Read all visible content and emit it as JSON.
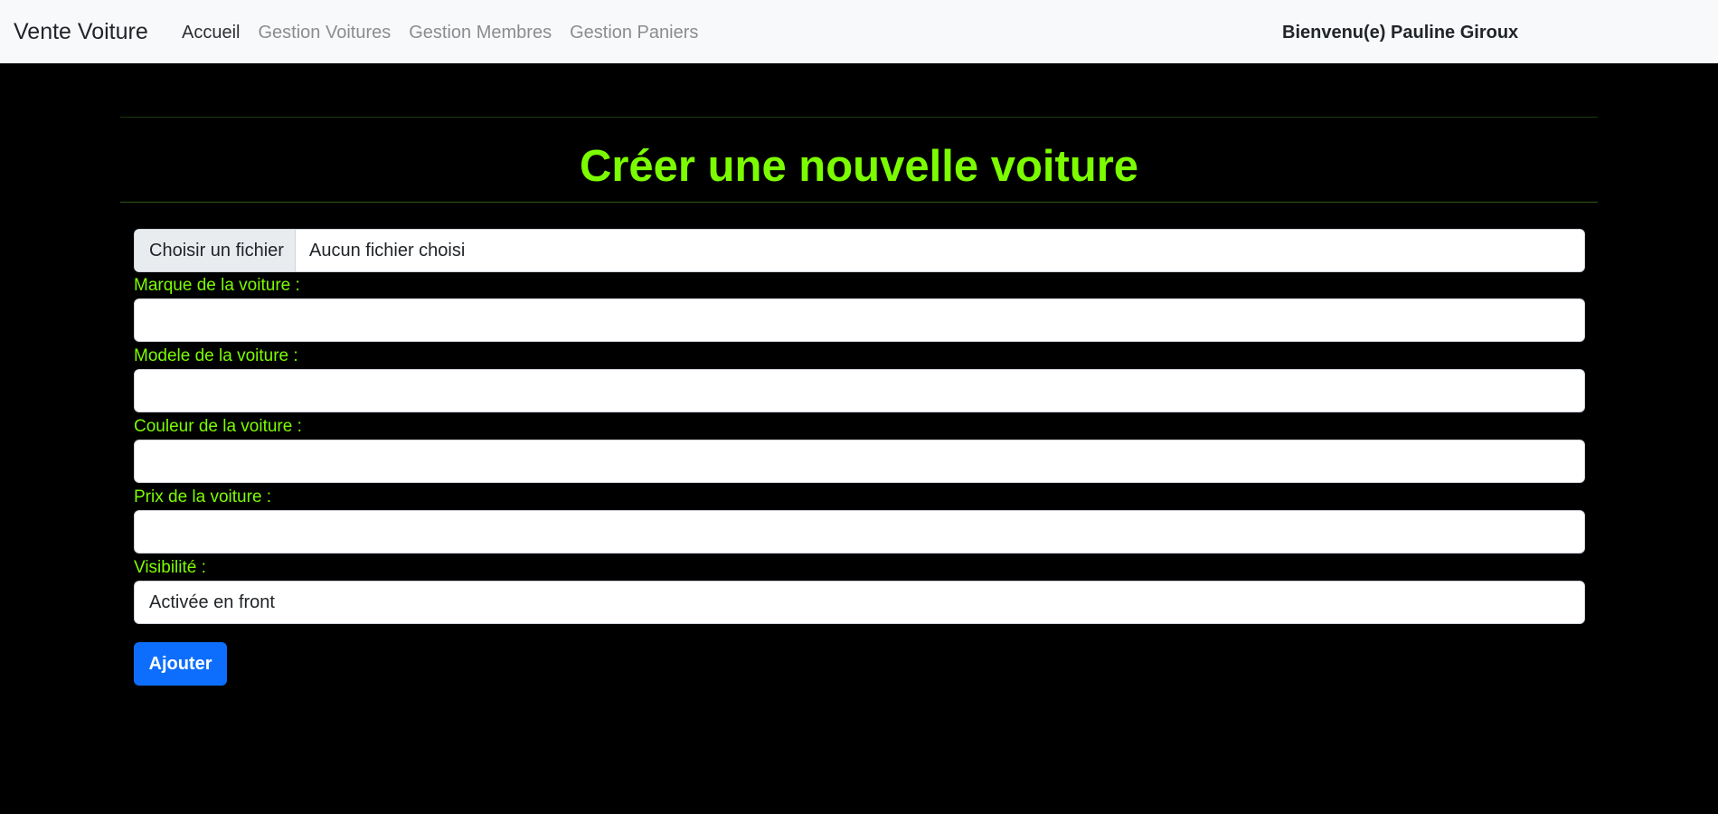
{
  "navbar": {
    "brand": "Vente Voiture",
    "links": [
      {
        "label": "Accueil",
        "active": true
      },
      {
        "label": "Gestion Voitures",
        "active": false
      },
      {
        "label": "Gestion Membres",
        "active": false
      },
      {
        "label": "Gestion Paniers",
        "active": false
      }
    ],
    "welcome": "Bienvenu(e) Pauline Giroux"
  },
  "page": {
    "title": "Créer une nouvelle voiture"
  },
  "form": {
    "file": {
      "button_label": "Choisir un fichier",
      "status": "Aucun fichier choisi"
    },
    "fields": [
      {
        "label": "Marque de la voiture :",
        "value": ""
      },
      {
        "label": "Modele de la voiture :",
        "value": ""
      },
      {
        "label": "Couleur de la voiture :",
        "value": ""
      },
      {
        "label": "Prix de la voiture :",
        "value": ""
      }
    ],
    "visibility": {
      "label": "Visibilité :",
      "selected": "Activée en front"
    },
    "submit_label": "Ajouter"
  },
  "colors": {
    "accent_green": "#7cfc00",
    "primary_blue": "#0d6efd",
    "background": "#000000",
    "navbar_bg": "#f8f9fa"
  }
}
